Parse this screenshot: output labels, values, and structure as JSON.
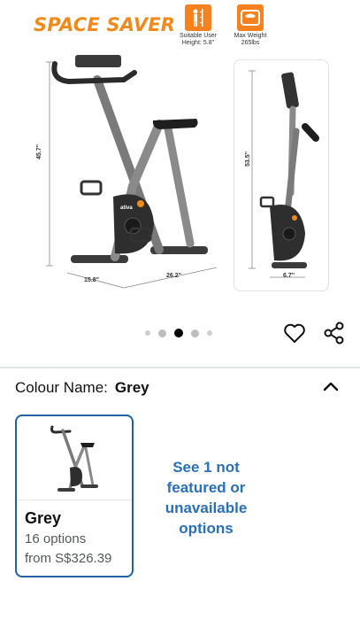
{
  "hero": {
    "brand_title": "SPACE SAVER",
    "specs": [
      {
        "icon": "user-height-icon",
        "caption_line1": "Suitable User",
        "caption_line2": "Height: 5.8''"
      },
      {
        "icon": "weight-scale-icon",
        "caption_line1": "Max Weight",
        "caption_line2": "265lbs"
      }
    ],
    "dimensions": {
      "height_open": "45.7''",
      "depth": "15.8''",
      "length": "26.2''",
      "height_folded": "53.5''",
      "width_folded": "6.7''"
    },
    "bike_logo": "ativa"
  },
  "carousel": {
    "total": 5,
    "active_index": 2
  },
  "actions": {
    "wishlist_icon": "heart-icon",
    "share_icon": "share-icon"
  },
  "colour": {
    "label": "Colour Name:",
    "value": "Grey",
    "collapse_icon": "chevron-up-icon"
  },
  "swatch": {
    "name": "Grey",
    "options": "16 options",
    "price": "from S$326.39"
  },
  "see_more": {
    "line1": "See 1 not",
    "line2": "featured or",
    "line3": "unavailable",
    "line4": "options"
  },
  "colors": {
    "brand_orange": "#f08a1c",
    "link_blue": "#2b6fb5",
    "swatch_border": "#2162a1"
  }
}
